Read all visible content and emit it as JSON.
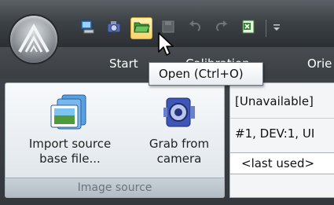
{
  "tabs": [
    {
      "label": "Start"
    },
    {
      "label": "Calibration"
    },
    {
      "label": "Orie"
    }
  ],
  "quick_access": [
    {
      "icon": "computer-icon"
    },
    {
      "icon": "camera-icon"
    },
    {
      "icon": "open-folder-icon",
      "active": true
    },
    {
      "icon": "save-icon"
    },
    {
      "icon": "undo-icon"
    },
    {
      "icon": "redo-icon"
    },
    {
      "icon": "excel-export-icon"
    },
    {
      "icon": "customize-dropdown-icon"
    }
  ],
  "tooltip": {
    "text": "Open (Ctrl+O)"
  },
  "ribbon": {
    "group_label": "Image source",
    "import_button": {
      "line1": "Import source",
      "line2": "base file..."
    },
    "grab_button": {
      "line1": "Grab from",
      "line2": "camera"
    },
    "right_panel": {
      "line1": "[Unavailable]",
      "line2": "#1, DEV:1, UI",
      "select_value": "<last used>"
    }
  },
  "colors": {
    "title_bar": "#3d4246",
    "ribbon_group": "#e7ecf0",
    "tooltip_border": "#6c747b",
    "active_button": "#f8d46a"
  }
}
